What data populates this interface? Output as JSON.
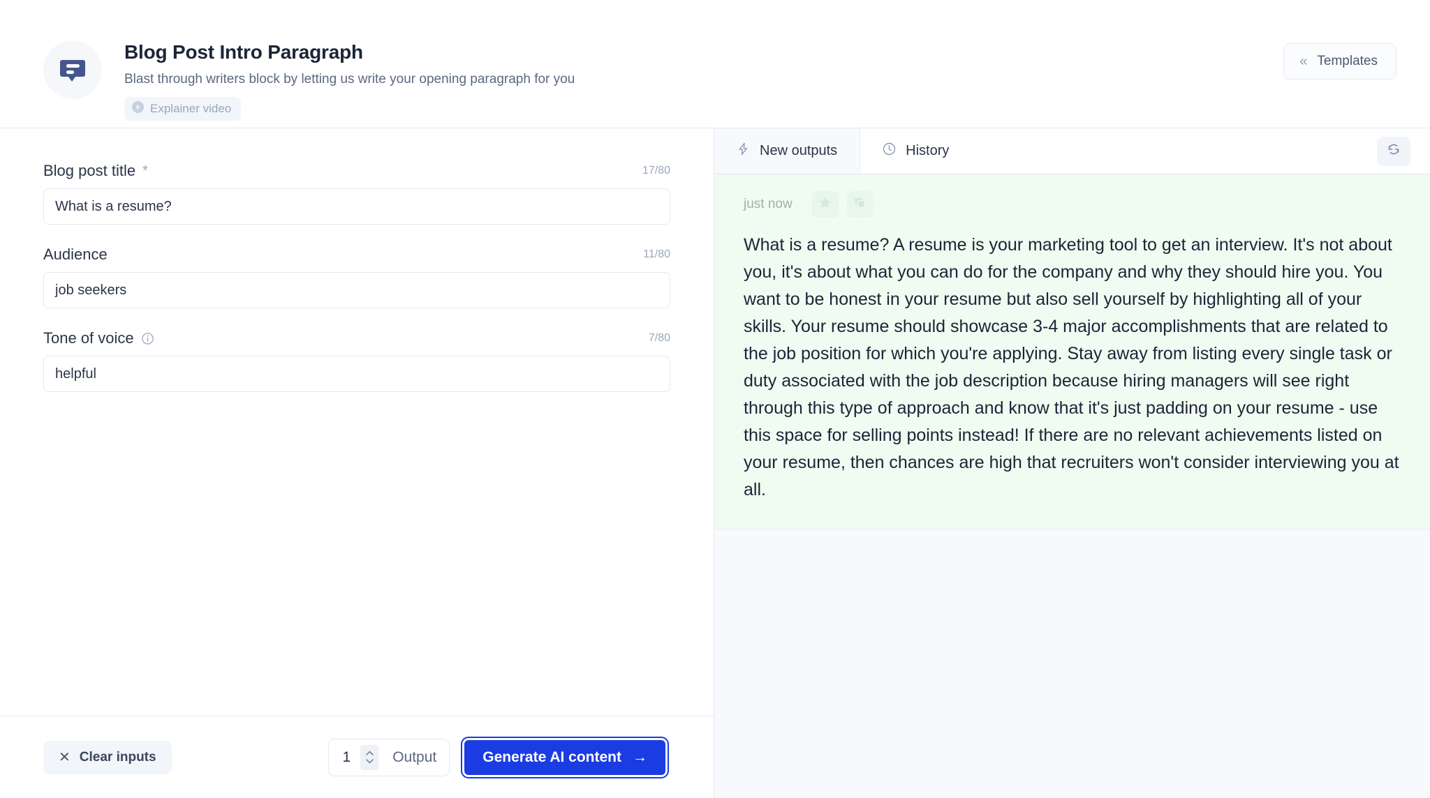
{
  "header": {
    "app_icon": "speech-bubble-icon",
    "title": "Blog Post Intro Paragraph",
    "subtitle": "Blast through writers block by letting us write your opening paragraph for you",
    "explainer_badge": {
      "icon": "play-circle-icon",
      "label": "Explainer video"
    },
    "templates_button": {
      "icon": "double-chevron-left-icon",
      "label": "Templates"
    }
  },
  "form": {
    "fields": [
      {
        "label": "Blog post title",
        "required_marker": "*",
        "char_count": "17/80",
        "value": "What is a resume?",
        "placeholder": "What is a resume?",
        "has_info_icon": false
      },
      {
        "label": "Audience",
        "required_marker": "",
        "char_count": "11/80",
        "value": "job seekers",
        "placeholder": "job seekers",
        "has_info_icon": false
      },
      {
        "label": "Tone of voice",
        "required_marker": "",
        "char_count": "7/80",
        "value": "helpful",
        "placeholder": "helpful",
        "has_info_icon": true
      }
    ]
  },
  "toolbar": {
    "clear_label": "Clear inputs",
    "clear_icon": "close-x-icon",
    "output_count": "1",
    "output_label": "Output",
    "generate_label": "Generate AI content",
    "generate_arrow": "→",
    "accent_color": "#1b3ce2"
  },
  "output_panel": {
    "tabs": [
      {
        "label": "New outputs",
        "icon": "lightning-bolt-icon",
        "active": true
      },
      {
        "label": "History",
        "icon": "clock-icon",
        "active": false
      }
    ],
    "refresh_icon": "refresh-icon",
    "card": {
      "timestamp": "just now",
      "star_icon": "star-icon",
      "copy_icon": "copy-icon",
      "background_color": "#f0fbf1",
      "text": "What is a resume? A resume is your marketing tool to get an interview. It's not about you, it's about what you can do for the company and why they should hire you. You want to be honest in your resume but also sell yourself by highlighting all of your skills. Your resume should showcase 3-4 major accomplishments that are related to the job position for which you're applying. Stay away from listing every single task or duty associated with the job description because hiring managers will see right through this type of approach and know that it's just padding on your resume - use this space for selling points instead! If there are no relevant achievements listed on your resume, then chances are high that recruiters won't consider interviewing you at all."
    }
  }
}
